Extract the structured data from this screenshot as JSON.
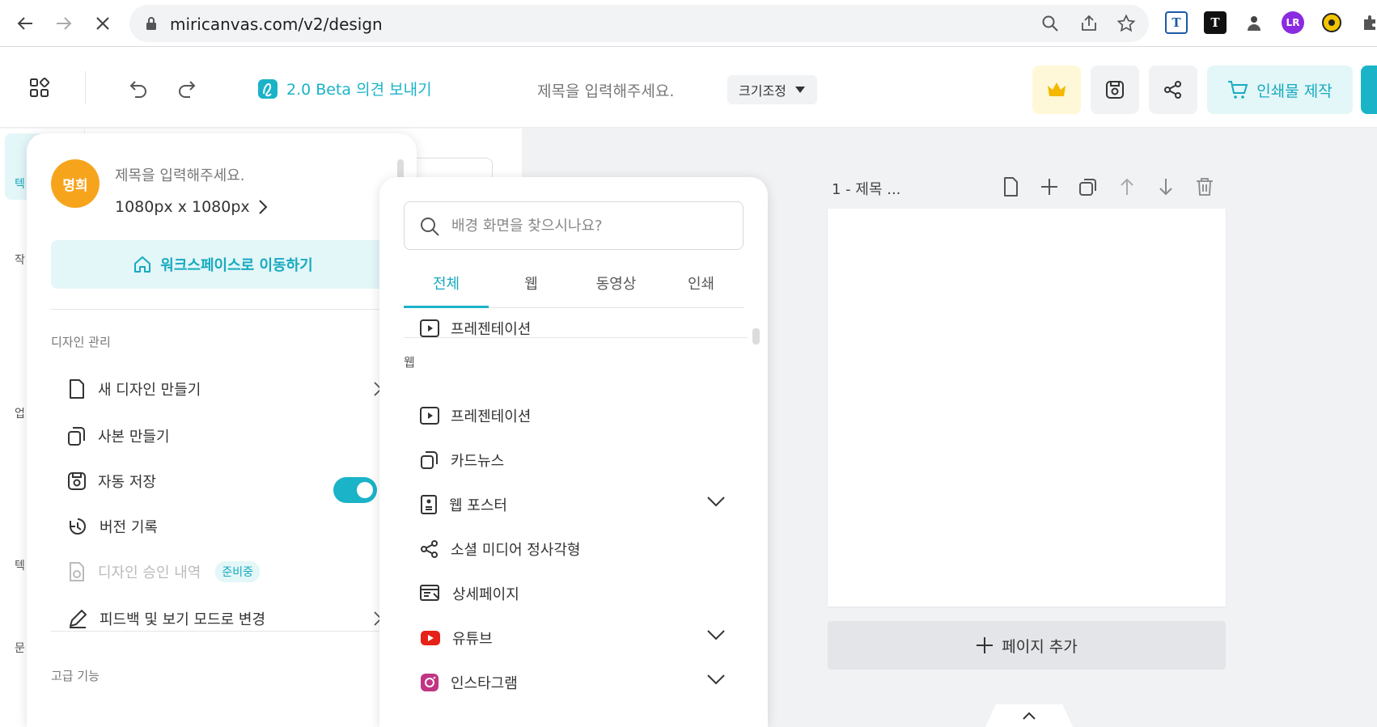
{
  "browser": {
    "url": "miricanvas.com/v2/design"
  },
  "header": {
    "beta_label": "2.0 Beta 의견 보내기",
    "title_placeholder": "제목을 입력해주세요.",
    "resize_label": "크기조정",
    "print_label": "인쇄물 제작"
  },
  "sidebar": {
    "labels": [
      "텍",
      "작",
      "업",
      "텍",
      "문"
    ]
  },
  "menu": {
    "avatar_text": "명희",
    "title": "제목을 입력해주세요.",
    "size": "1080px x 1080px",
    "workspace_button": "워크스페이스로 이동하기",
    "section_design": "디자인 관리",
    "items": {
      "new_design": "새 디자인 만들기",
      "copy": "사본 만들기",
      "autosave": "자동 저장",
      "version": "버전 기록",
      "approval": "디자인 승인 내역",
      "approval_badge": "준비중",
      "feedback": "피드백 및 보기 모드로 변경"
    },
    "section_advanced": "고급 기능",
    "autosave_on": true
  },
  "submenu": {
    "search_placeholder": "배경 화면을 찾으시나요?",
    "tabs": [
      "전체",
      "웹",
      "동영상",
      "인쇄"
    ],
    "active_tab": "전체",
    "top_item": "프레젠테이션",
    "section_web": "웹",
    "items": [
      "프레젠테이션",
      "카드뉴스",
      "웹 포스터",
      "소셜 미디어 정사각형",
      "상세페이지",
      "유튜브",
      "인스타그램"
    ]
  },
  "canvas": {
    "page_label": "1 - 제목 ...",
    "add_page": "페이지 추가"
  },
  "colors": {
    "accent": "#1ab3c8",
    "avatar": "#f7a41d",
    "youtube": "#e62117"
  }
}
